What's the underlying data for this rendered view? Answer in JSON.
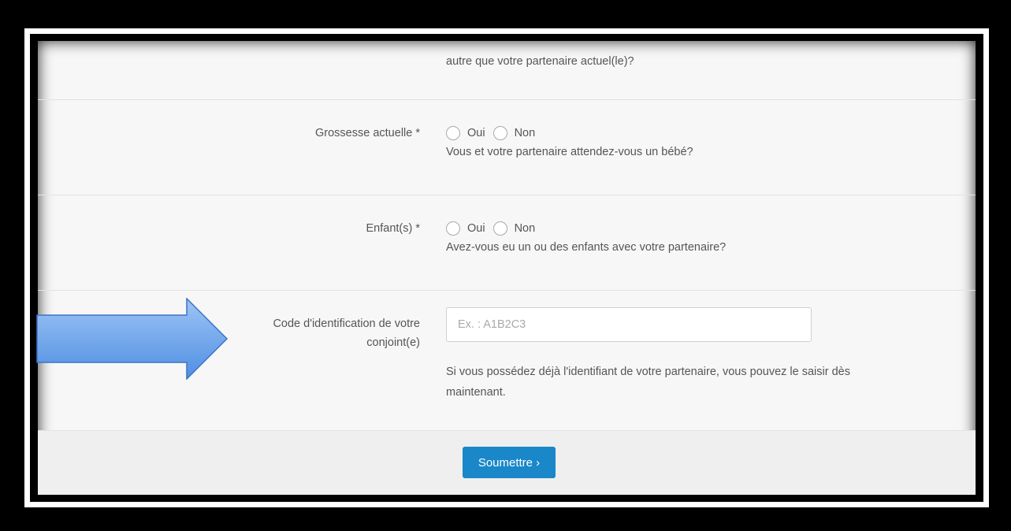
{
  "rows": {
    "previous": {
      "hint_cut": "— — — — — — — — — — — — — — — — — — — — — — —",
      "hint": "autre que votre partenaire actuel(le)?"
    },
    "pregnancy": {
      "label": "Grossesse actuelle *",
      "option_yes": "Oui",
      "option_no": "Non",
      "hint": "Vous et votre partenaire attendez-vous un bébé?"
    },
    "children": {
      "label": "Enfant(s) *",
      "option_yes": "Oui",
      "option_no": "Non",
      "hint": "Avez-vous eu un ou des enfants avec votre partenaire?"
    },
    "partner_code": {
      "label_line1": "Code d'identification de votre",
      "label_line2": "conjoint(e)",
      "placeholder": "Ex. : A1B2C3",
      "value": "",
      "hint_line1": "Si vous possédez déjà l'identifiant de votre partenaire, vous pouvez le saisir dès",
      "hint_line2": "maintenant."
    }
  },
  "footer": {
    "submit_label": "Soumettre ›"
  },
  "colors": {
    "accent": "#1a87c9",
    "arrow": "#5f9be8"
  },
  "icons": {
    "annotation": "right-arrow-icon"
  }
}
